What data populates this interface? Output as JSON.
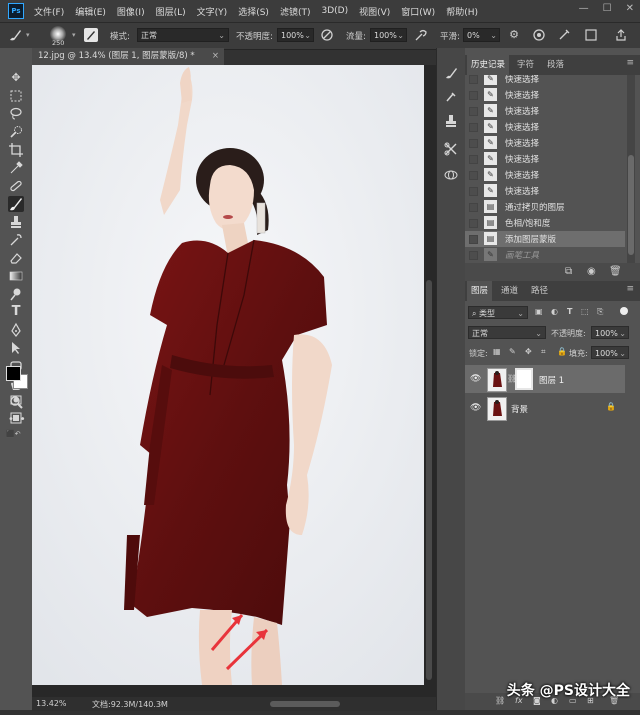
{
  "app": {
    "logo": "Ps"
  },
  "menu": [
    "文件(F)",
    "编辑(E)",
    "图像(I)",
    "图层(L)",
    "文字(Y)",
    "选择(S)",
    "滤镜(T)",
    "3D(D)",
    "视图(V)",
    "窗口(W)",
    "帮助(H)"
  ],
  "window_controls": [
    "—",
    "☐",
    "✕"
  ],
  "options": {
    "brush_size": "250",
    "mode_label": "模式:",
    "mode_value": "正常",
    "opacity_label": "不透明度:",
    "opacity_value": "100%",
    "flow_label": "流量:",
    "flow_value": "100%",
    "smooth_label": "平滑:",
    "smooth_value": "0%"
  },
  "document": {
    "tab_title": "12.jpg @ 13.4% (图层 1, 图层蒙版/8) *",
    "zoom": "13.42%",
    "doc_info": "文档:92.3M/140.3M"
  },
  "history_panel": {
    "tabs": [
      "历史记录",
      "字符",
      "段落"
    ],
    "items": [
      {
        "label": "快速选择",
        "icon": "brush-icon",
        "state": "normal"
      },
      {
        "label": "快速选择",
        "icon": "brush-icon",
        "state": "normal"
      },
      {
        "label": "快速选择",
        "icon": "brush-icon",
        "state": "normal"
      },
      {
        "label": "快速选择",
        "icon": "brush-icon",
        "state": "normal"
      },
      {
        "label": "快速选择",
        "icon": "brush-icon",
        "state": "normal"
      },
      {
        "label": "快速选择",
        "icon": "brush-icon",
        "state": "normal"
      },
      {
        "label": "快速选择",
        "icon": "brush-icon",
        "state": "normal"
      },
      {
        "label": "快速选择",
        "icon": "brush-icon",
        "state": "normal"
      },
      {
        "label": "通过拷贝的图层",
        "icon": "document-icon",
        "state": "normal"
      },
      {
        "label": "色相/饱和度",
        "icon": "document-icon",
        "state": "normal"
      },
      {
        "label": "添加图层蒙版",
        "icon": "document-icon",
        "state": "selected"
      },
      {
        "label": "画笔工具",
        "icon": "brush-icon",
        "state": "future"
      }
    ]
  },
  "layers_panel": {
    "tabs": [
      "图层",
      "通道",
      "路径"
    ],
    "filter_label": "类型",
    "blend_mode": "正常",
    "opacity_label": "不透明度:",
    "opacity_value": "100%",
    "lock_label": "锁定:",
    "fill_label": "填充:",
    "fill_value": "100%",
    "layers": [
      {
        "name": "图层 1",
        "visible": true,
        "has_mask": true,
        "selected": true
      },
      {
        "name": "背景",
        "visible": true,
        "has_mask": false,
        "locked": true,
        "selected": false
      }
    ]
  },
  "watermark": "头条 @PS设计大全"
}
